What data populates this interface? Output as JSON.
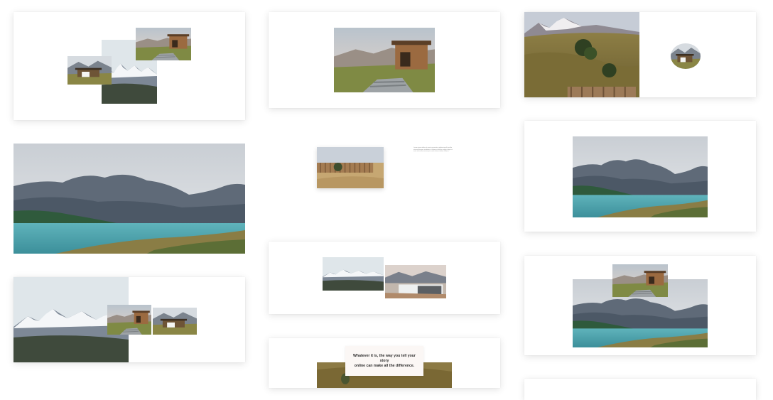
{
  "blog": {
    "excerpt": "Lorem ipsum dolor sit amet consectetur adipiscing elit sed do eiusmod tempor incididunt",
    "excerpt2": "ut labore et dolore magna aliqua ut enim ad minim veniam quis nostrud exercitation ullamco"
  },
  "quote": {
    "text": "Whatever it is, the way you tell your story\nonline can make all the difference."
  },
  "colors": {
    "sky": "#d8dde2",
    "mountain": "#6e7784",
    "lake": "#4aa3ad",
    "grass": "#8a7b3d",
    "cabin": "#9a6d47"
  }
}
